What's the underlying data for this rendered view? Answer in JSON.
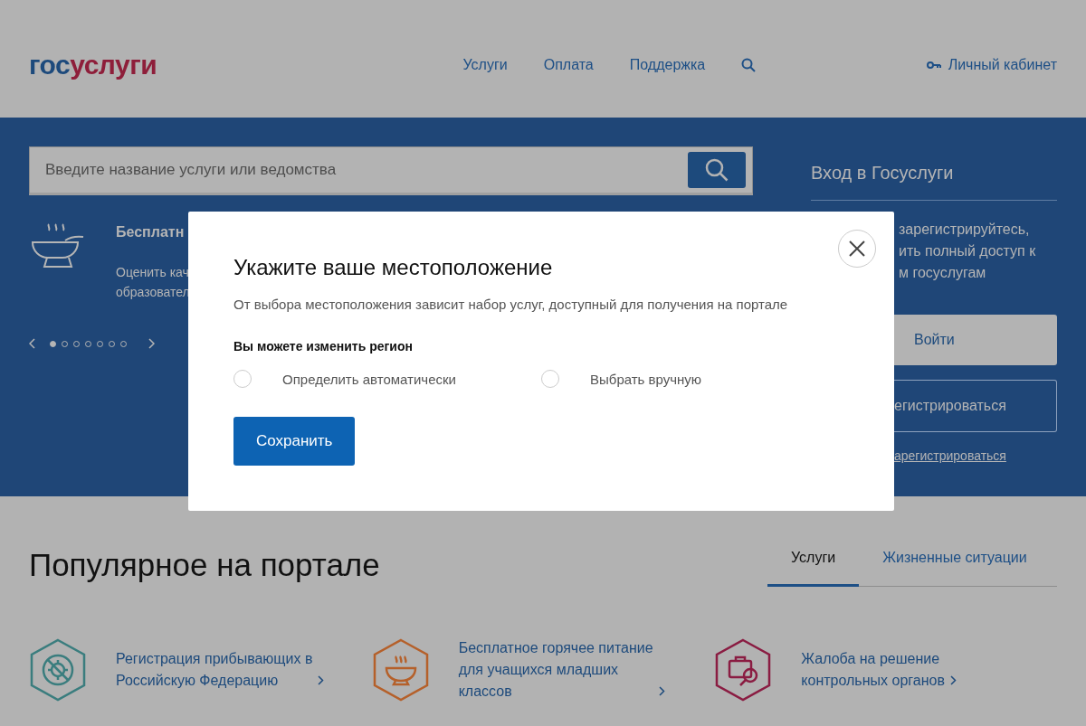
{
  "header": {
    "logo": {
      "first": "гос",
      "second": "услуги"
    },
    "nav": [
      {
        "label": "Услуги"
      },
      {
        "label": "Оплата"
      },
      {
        "label": "Поддержка"
      }
    ],
    "account": "Личный кабинет"
  },
  "search": {
    "placeholder": "Введите название услуги или ведомства"
  },
  "promo": {
    "title": "Бесплатн",
    "lines": [
      "Оценить кач",
      "образовател"
    ],
    "dots": [
      {
        "selected": true
      },
      {
        "selected": false
      },
      {
        "selected": false
      },
      {
        "selected": false
      },
      {
        "selected": false
      },
      {
        "selected": false
      },
      {
        "selected": false
      }
    ]
  },
  "login": {
    "title": "Вход в Госуслуги",
    "lines": [
      "зарегистрируйтесь,",
      "ить полный доступ к",
      "м госуслугам"
    ],
    "login_button": "Войти",
    "register_button": "егистрироваться",
    "register_link": "арегистрироваться"
  },
  "popular": {
    "title": "Популярное на портале",
    "tabs": [
      {
        "label": "Услуги",
        "selected": true
      },
      {
        "label": "Жизненные ситуации",
        "selected": false
      }
    ],
    "cards": [
      {
        "text": "Регистрация прибывающих в\nРоссийскую Федерацию"
      },
      {
        "text": "Бесплатное горячее питание\nдля учащихся младших\nклассов"
      },
      {
        "text": "Жалоба на решение\nконтрольных органов"
      }
    ]
  },
  "dialog": {
    "title": "Укажите ваше местоположение",
    "subtitle": "От выбора местоположения зависит набор услуг, доступный для получения на портале",
    "label": "Вы можете изменить регион",
    "options": [
      {
        "label": "Определить автоматически",
        "selected": false
      },
      {
        "label": "Выбрать вручную",
        "selected": false
      }
    ],
    "save": "Сохранить"
  }
}
